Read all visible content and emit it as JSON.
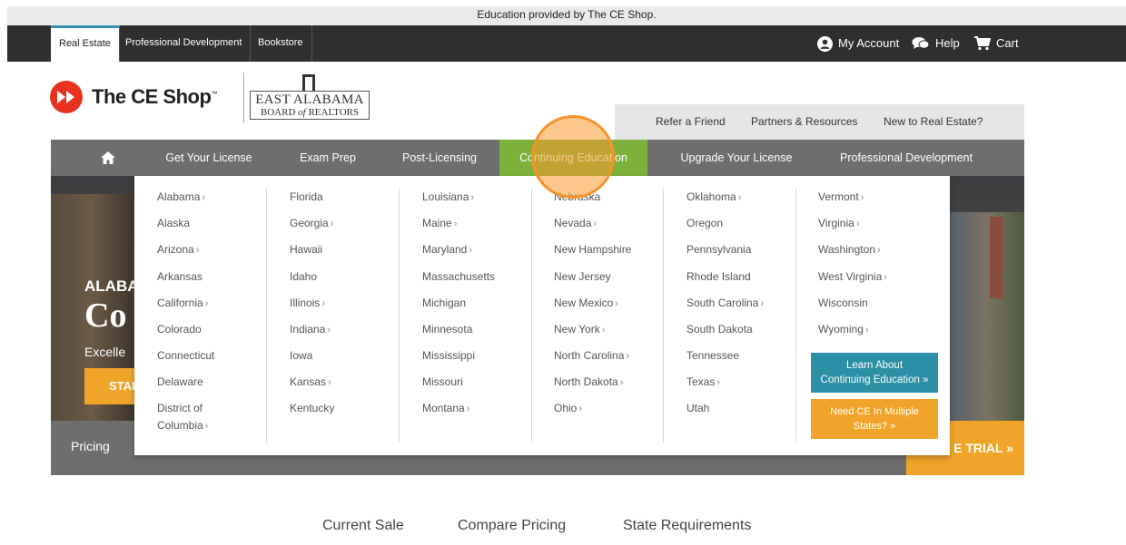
{
  "banner": {
    "text": "Education provided by The CE Shop."
  },
  "topbar": {
    "tabs": [
      "Real Estate",
      "Professional Development",
      "Bookstore"
    ],
    "account_label": "My Account",
    "help_label": "Help",
    "cart_label": "Cart"
  },
  "brand": {
    "logo_text": "The CE Shop",
    "logo_tm": "™",
    "partner_line1": "EAST ALABAMA",
    "partner_line2_pre": "BOARD",
    "partner_line2_of": "of",
    "partner_line2_post": "REALTORS"
  },
  "utility_links": [
    "Refer a Friend",
    "Partners & Resources",
    "New to Real Estate?"
  ],
  "main_nav": {
    "home_icon": "home-icon",
    "items": [
      "Get Your License",
      "Exam Prep",
      "Post-Licensing",
      "Continuing Education",
      "Upgrade Your License",
      "Professional Development"
    ],
    "active": "Continuing Education"
  },
  "hero": {
    "eyebrow": "ALABA",
    "headline": "Co",
    "subtext": "Excelle",
    "button": "STAI"
  },
  "strip": {
    "pricing_label": "Pricing",
    "trial_label": "E TRIAL »"
  },
  "mega_menu": {
    "columns": [
      [
        {
          "name": "Alabama",
          "arrow": true
        },
        {
          "name": "Alaska",
          "arrow": false
        },
        {
          "name": "Arizona",
          "arrow": true
        },
        {
          "name": "Arkansas",
          "arrow": false
        },
        {
          "name": "California",
          "arrow": true
        },
        {
          "name": "Colorado",
          "arrow": false
        },
        {
          "name": "Connecticut",
          "arrow": false
        },
        {
          "name": "Delaware",
          "arrow": false
        },
        {
          "name": "District of",
          "arrow": false
        },
        {
          "name": "Columbia",
          "arrow": true
        }
      ],
      [
        {
          "name": "Florida",
          "arrow": false
        },
        {
          "name": "Georgia",
          "arrow": true
        },
        {
          "name": "Hawaii",
          "arrow": false
        },
        {
          "name": "Idaho",
          "arrow": false
        },
        {
          "name": "Illinois",
          "arrow": true
        },
        {
          "name": "Indiana",
          "arrow": true
        },
        {
          "name": "Iowa",
          "arrow": false
        },
        {
          "name": "Kansas",
          "arrow": true
        },
        {
          "name": "Kentucky",
          "arrow": false
        }
      ],
      [
        {
          "name": "Louisiana",
          "arrow": true
        },
        {
          "name": "Maine",
          "arrow": true
        },
        {
          "name": "Maryland",
          "arrow": true
        },
        {
          "name": "Massachusetts",
          "arrow": false
        },
        {
          "name": "Michigan",
          "arrow": false
        },
        {
          "name": "Minnesota",
          "arrow": false
        },
        {
          "name": "Mississippi",
          "arrow": false
        },
        {
          "name": "Missouri",
          "arrow": false
        },
        {
          "name": "Montana",
          "arrow": true
        }
      ],
      [
        {
          "name": "Nebraska",
          "arrow": false
        },
        {
          "name": "Nevada",
          "arrow": true
        },
        {
          "name": "New Hampshire",
          "arrow": false
        },
        {
          "name": "New Jersey",
          "arrow": false
        },
        {
          "name": "New Mexico",
          "arrow": true
        },
        {
          "name": "New York",
          "arrow": true
        },
        {
          "name": "North Carolina",
          "arrow": true
        },
        {
          "name": "North Dakota",
          "arrow": true
        },
        {
          "name": "Ohio",
          "arrow": true
        }
      ],
      [
        {
          "name": "Oklahoma",
          "arrow": true
        },
        {
          "name": "Oregon",
          "arrow": false
        },
        {
          "name": "Pennsylvania",
          "arrow": false
        },
        {
          "name": "Rhode Island",
          "arrow": false
        },
        {
          "name": "South Carolina",
          "arrow": true
        },
        {
          "name": "South Dakota",
          "arrow": false
        },
        {
          "name": "Tennessee",
          "arrow": false
        },
        {
          "name": "Texas",
          "arrow": true
        },
        {
          "name": "Utah",
          "arrow": false
        }
      ],
      [
        {
          "name": "Vermont",
          "arrow": true
        },
        {
          "name": "Virginia",
          "arrow": true
        },
        {
          "name": "Washington",
          "arrow": true
        },
        {
          "name": "West Virginia",
          "arrow": true
        },
        {
          "name": "Wisconsin",
          "arrow": false
        },
        {
          "name": "Wyoming",
          "arrow": true
        }
      ]
    ],
    "cta_learn_line1": "Learn About",
    "cta_learn_line2": "Continuing Education »",
    "cta_multi_line1": "Need CE In Multiple",
    "cta_multi_line2": "States? »"
  },
  "bottom_nav": [
    "Current Sale",
    "Compare Pricing",
    "State Requirements"
  ],
  "colors": {
    "active_nav": "#7cb13b",
    "accent_orange": "#f0a429",
    "cta_blue": "#2b8fa6",
    "brand_red": "#e8321f"
  }
}
